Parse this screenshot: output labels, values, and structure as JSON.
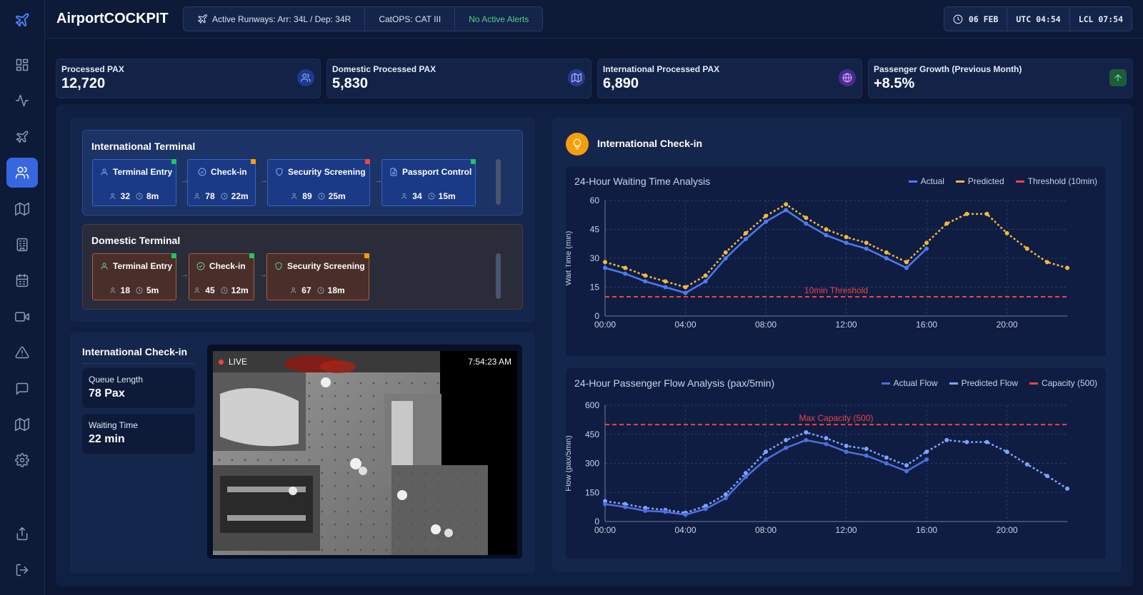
{
  "app": {
    "title": "AirportCOCKPIT"
  },
  "status": {
    "runways": "Active Runways: Arr: 34L / Dep: 34R",
    "catops": "CatOPS: CAT III",
    "alerts": "No Active Alerts"
  },
  "time": {
    "date": "06 FEB",
    "utc": "UTC 04:54",
    "lcl": "LCL 07:54"
  },
  "sidebar": {
    "items": [
      "dashboard-icon",
      "activity-icon",
      "flights-icon",
      "passengers-icon",
      "map-icon",
      "building-icon",
      "calendar-icon",
      "camera-icon",
      "alert-icon",
      "messages-icon",
      "map-alt-icon",
      "settings-icon",
      "export-icon",
      "logout-icon"
    ],
    "active": "passengers-icon"
  },
  "kpis": [
    {
      "label": "Processed PAX",
      "value": "12,720",
      "icon": "users-icon",
      "color": "#3b6cf0"
    },
    {
      "label": "Domestic Processed PAX",
      "value": "5,830",
      "icon": "map-icon",
      "color": "#4a63d9"
    },
    {
      "label": "International Processed PAX",
      "value": "6,890",
      "icon": "globe-icon",
      "color": "#7c4ddb"
    },
    {
      "label": "Passenger Growth (Previous Month)",
      "value": "+8.5%",
      "icon": "arrow-up-icon",
      "color": "#2f8a55"
    }
  ],
  "terminals": {
    "international": {
      "title": "International Terminal",
      "stages": [
        {
          "name": "Terminal Entry",
          "pax": "32",
          "time": "8m",
          "status": "#22c55e"
        },
        {
          "name": "Check-in",
          "pax": "78",
          "time": "22m",
          "status": "#f59e0b"
        },
        {
          "name": "Security Screening",
          "pax": "89",
          "time": "25m",
          "status": "#ef4444"
        },
        {
          "name": "Passport Control",
          "pax": "34",
          "time": "15m",
          "status": "#22c55e"
        }
      ]
    },
    "domestic": {
      "title": "Domestic Terminal",
      "stages": [
        {
          "name": "Terminal Entry",
          "pax": "18",
          "time": "5m",
          "status": "#22c55e"
        },
        {
          "name": "Check-in",
          "pax": "45",
          "time": "12m",
          "status": "#22c55e"
        },
        {
          "name": "Security Screening",
          "pax": "67",
          "time": "18m",
          "status": "#f59e0b"
        }
      ]
    }
  },
  "camera": {
    "title": "International Check-in",
    "queue_label": "Queue Length",
    "queue_value": "78 Pax",
    "wait_label": "Waiting Time",
    "wait_value": "22 min",
    "live": "LIVE",
    "timestamp": "7:54:23 AM"
  },
  "right": {
    "title": "International Check-in"
  },
  "chart_data": [
    {
      "type": "line",
      "title": "24-Hour Waiting Time Analysis",
      "ylabel": "Wait Time (min)",
      "xticks": [
        "00:00",
        "04:00",
        "08:00",
        "12:00",
        "16:00",
        "20:00"
      ],
      "yticks": [
        "0",
        "15",
        "30",
        "45",
        "60"
      ],
      "xlim": [
        0,
        23
      ],
      "ylim": [
        0,
        60
      ],
      "threshold": {
        "value": 10,
        "label": "10min Threshold",
        "legend": "Threshold (10min)"
      },
      "series": [
        {
          "name": "Actual",
          "color": "#4f7bf0",
          "dash": false,
          "x": [
            0,
            1,
            2,
            3,
            4,
            5,
            6,
            7,
            8,
            9,
            10,
            11,
            12,
            13,
            14,
            15,
            16
          ],
          "values": [
            25,
            22,
            18,
            15,
            12,
            18,
            30,
            40,
            49,
            55,
            48,
            42,
            38,
            35,
            30,
            25,
            35
          ]
        },
        {
          "name": "Predicted",
          "color": "#f5b83c",
          "dash": true,
          "x": [
            0,
            1,
            2,
            3,
            4,
            5,
            6,
            7,
            8,
            9,
            10,
            11,
            12,
            13,
            14,
            15,
            16,
            17,
            18,
            19,
            20,
            21,
            22,
            23
          ],
          "values": [
            28,
            25,
            21,
            18,
            15,
            21,
            33,
            43,
            52,
            58,
            51,
            45,
            41,
            38,
            33,
            28,
            38,
            48,
            53,
            53,
            43,
            35,
            28,
            25
          ]
        }
      ]
    },
    {
      "type": "line",
      "title": "24-Hour Passenger Flow Analysis (pax/5min)",
      "ylabel": "Flow (pax/5min)",
      "xticks": [
        "00:00",
        "04:00",
        "08:00",
        "12:00",
        "16:00",
        "20:00"
      ],
      "yticks": [
        "0",
        "150",
        "300",
        "450",
        "600"
      ],
      "xlim": [
        0,
        23
      ],
      "ylim": [
        0,
        600
      ],
      "threshold": {
        "value": 500,
        "label": "Max Capacity (500)",
        "legend": "Capacity (500)"
      },
      "series": [
        {
          "name": "Actual Flow",
          "color": "#4f6fe0",
          "dash": false,
          "x": [
            0,
            1,
            2,
            3,
            4,
            5,
            6,
            7,
            8,
            9,
            10,
            11,
            12,
            13,
            14,
            15,
            16
          ],
          "values": [
            90,
            75,
            55,
            50,
            35,
            65,
            120,
            230,
            320,
            380,
            420,
            400,
            360,
            340,
            300,
            260,
            320
          ]
        },
        {
          "name": "Predicted Flow",
          "color": "#7fa4ff",
          "dash": true,
          "x": [
            0,
            1,
            2,
            3,
            4,
            5,
            6,
            7,
            8,
            9,
            10,
            11,
            12,
            13,
            14,
            15,
            16,
            17,
            18,
            19,
            20,
            21,
            22,
            23
          ],
          "values": [
            105,
            90,
            70,
            60,
            45,
            80,
            140,
            250,
            360,
            420,
            460,
            430,
            390,
            375,
            330,
            290,
            360,
            420,
            410,
            410,
            360,
            295,
            235,
            170
          ]
        }
      ]
    }
  ]
}
